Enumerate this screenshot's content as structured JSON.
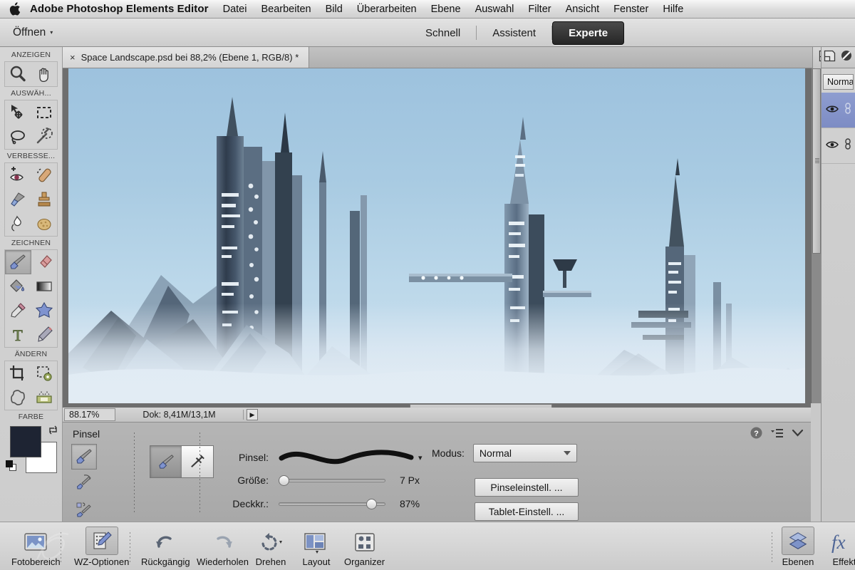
{
  "menubar": {
    "apple_icon": "apple-logo",
    "app_title": "Adobe Photoshop Elements Editor",
    "items": [
      "Datei",
      "Bearbeiten",
      "Bild",
      "Überarbeiten",
      "Ebene",
      "Auswahl",
      "Filter",
      "Ansicht",
      "Fenster",
      "Hilfe"
    ]
  },
  "modebar": {
    "open_label": "Öffnen",
    "open_caret": "▾",
    "tabs": [
      {
        "label": "Schnell",
        "active": false
      },
      {
        "label": "Assistent",
        "active": false
      },
      {
        "label": "Experte",
        "active": true
      }
    ]
  },
  "document": {
    "close_glyph": "×",
    "tab_title": "Space Landscape.psd bei 88,2% (Ebene 1, RGB/8) *"
  },
  "toolbar": {
    "groups": [
      {
        "label": "ANZEIGEN",
        "tools": [
          {
            "name": "zoom-tool",
            "icon": "magnifier-icon",
            "selected": false
          },
          {
            "name": "hand-tool",
            "icon": "hand-icon",
            "selected": false
          }
        ]
      },
      {
        "label": "AUSWÄH...",
        "tools": [
          {
            "name": "move-tool",
            "icon": "move-arrow-icon",
            "selected": false
          },
          {
            "name": "rectangular-marquee-tool",
            "icon": "dashed-rectangle-icon",
            "selected": false
          },
          {
            "name": "lasso-tool",
            "icon": "lasso-icon",
            "selected": false
          },
          {
            "name": "magic-wand-tool",
            "icon": "magic-wand-icon",
            "selected": false
          }
        ]
      },
      {
        "label": "VERBESSE...",
        "tools": [
          {
            "name": "red-eye-tool",
            "icon": "eye-plus-icon",
            "selected": false
          },
          {
            "name": "spot-healing-tool",
            "icon": "healing-bandage-icon",
            "selected": false
          },
          {
            "name": "smart-brush-tool",
            "icon": "paint-blob-icon",
            "selected": false
          },
          {
            "name": "clone-stamp-tool",
            "icon": "stamp-icon",
            "selected": false
          },
          {
            "name": "blur-tool",
            "icon": "water-drop-hand-icon",
            "selected": false
          },
          {
            "name": "sponge-tool",
            "icon": "sponge-icon",
            "selected": false
          }
        ]
      },
      {
        "label": "ZEICHNEN",
        "tools": [
          {
            "name": "brush-tool",
            "icon": "paintbrush-icon",
            "selected": true
          },
          {
            "name": "eraser-tool",
            "icon": "eraser-icon",
            "selected": false
          },
          {
            "name": "paint-bucket-tool",
            "icon": "paint-bucket-icon",
            "selected": false
          },
          {
            "name": "gradient-tool",
            "icon": "gradient-icon",
            "selected": false
          },
          {
            "name": "eyedropper-tool",
            "icon": "eyedropper-icon",
            "selected": false
          },
          {
            "name": "custom-shape-tool",
            "icon": "star-shape-icon",
            "selected": false
          },
          {
            "name": "type-tool",
            "icon": "type-t-icon",
            "selected": false
          },
          {
            "name": "pencil-tool",
            "icon": "pencil-icon",
            "selected": false
          }
        ]
      },
      {
        "label": "ÄNDERN",
        "tools": [
          {
            "name": "crop-tool",
            "icon": "crop-icon",
            "selected": false
          },
          {
            "name": "recompose-tool",
            "icon": "recompose-gear-icon",
            "selected": false
          },
          {
            "name": "cookie-cutter-tool",
            "icon": "cookie-cutter-icon",
            "selected": false
          },
          {
            "name": "straighten-tool",
            "icon": "straighten-icon",
            "selected": false
          }
        ]
      }
    ],
    "color_label": "FARBE",
    "foreground_color": "#1e2433",
    "background_color": "#ffffff"
  },
  "statusbar": {
    "zoom_value": "88.17%",
    "doc_info": "Dok: 8,41M/13,1M",
    "arrow_glyph": "▶"
  },
  "options": {
    "title": "Pinsel",
    "tool_variants": [
      {
        "name": "brush-variant",
        "icon": "paintbrush-icon",
        "selected": true
      },
      {
        "name": "impressionist-brush-variant",
        "icon": "impressionist-brush-icon",
        "selected": false
      },
      {
        "name": "color-replacement-brush-variant",
        "icon": "color-replace-brush-icon",
        "selected": false
      }
    ],
    "segmented": [
      {
        "name": "brush-mode",
        "icon": "paintbrush-icon",
        "selected": true
      },
      {
        "name": "airbrush-mode",
        "icon": "airbrush-icon",
        "selected": false
      }
    ],
    "brush_label": "Pinsel:",
    "brush_preview_caret": "▾",
    "size_label": "Größe:",
    "size_value": "7 Px",
    "size_percent": 4,
    "opacity_label": "Deckkr.:",
    "opacity_value": "87%",
    "opacity_percent": 87,
    "mode_label": "Modus:",
    "mode_value": "Normal",
    "brush_settings_button": "Pinseleinstell. ...",
    "tablet_settings_button": "Tablet-Einstell. ...",
    "panel_controls": [
      {
        "name": "help-icon",
        "glyph": "?"
      },
      {
        "name": "panel-menu-icon",
        "glyph": "≡"
      },
      {
        "name": "chevron-down-icon",
        "glyph": "⌄"
      }
    ]
  },
  "right_panel": {
    "icons": [
      {
        "name": "new-layer-icon"
      },
      {
        "name": "adjustment-layer-icon"
      }
    ],
    "blend_mode": "Normal",
    "layers": [
      {
        "name": "layer-row-1",
        "visible_icon": "eye-icon",
        "link_icon": "link-icon",
        "selected": true
      },
      {
        "name": "layer-row-2",
        "visible_icon": "eye-icon",
        "link_icon": "link-icon",
        "selected": false
      }
    ]
  },
  "bottombar": {
    "items": [
      {
        "name": "photo-bin-button",
        "label": "Fotobereich",
        "icon": "photo-stack-icon",
        "selected": false,
        "caret": false
      },
      {
        "name": "tool-options-button",
        "label": "WZ-Optionen",
        "icon": "tool-options-icon",
        "selected": true,
        "caret": false
      },
      {
        "name": "undo-button",
        "label": "Rückgängig",
        "icon": "undo-arrow-icon",
        "selected": false,
        "caret": false
      },
      {
        "name": "redo-button",
        "label": "Wiederholen",
        "icon": "redo-arrow-icon",
        "selected": false,
        "caret": false
      },
      {
        "name": "rotate-button",
        "label": "Drehen",
        "icon": "rotate-icon",
        "selected": false,
        "caret": true
      },
      {
        "name": "layout-button",
        "label": "Layout",
        "icon": "layout-grid-icon",
        "selected": false,
        "caret": true
      },
      {
        "name": "organizer-button",
        "label": "Organizer",
        "icon": "organizer-icon",
        "selected": false,
        "caret": false
      }
    ],
    "right_items": [
      {
        "name": "layers-button",
        "label": "Ebenen",
        "icon": "layers-stack-icon",
        "selected": true
      },
      {
        "name": "effects-button",
        "label": "Effekt",
        "icon": "fx-icon",
        "selected": false
      }
    ]
  },
  "artwork": {
    "title": "Space Landscape",
    "description": "Digital painting of futuristic ice-planet city with tall spires above snowy mountains",
    "sky_top": "#9dc2de",
    "sky_bottom": "#cfe2ef",
    "tower_dark": "#3c4a5a",
    "tower_mid": "#6e8196",
    "snow": "#e4eef5"
  }
}
